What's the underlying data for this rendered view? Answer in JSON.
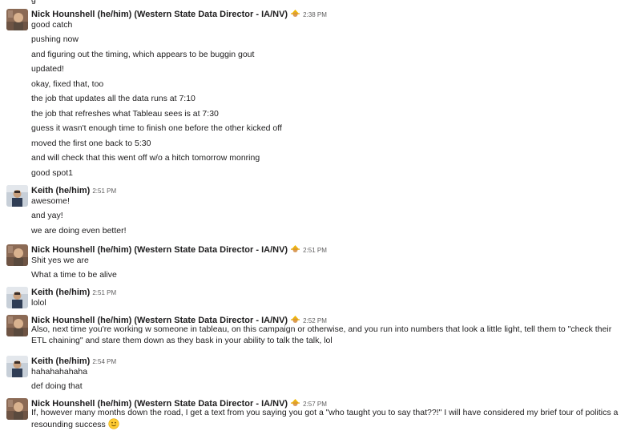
{
  "top_fragment": "g",
  "colors": {
    "text": "#1d1c1d",
    "timestamp": "#616061",
    "background": "#ffffff"
  },
  "groups": [
    {
      "sender": "Nick Hounshell (he/him) (Western State Data Director - IA/NV)",
      "status_emoji": "construction-worker-emoji",
      "time": "2:38 PM",
      "lines": [
        "good catch",
        "pushing now",
        "and figuring out the timing, which appears to be buggin gout",
        "updated!",
        "okay, fixed that, too",
        "the job that updates all the data runs at 7:10",
        "the job that refreshes what Tableau sees is at 7:30",
        "guess it wasn't enough time to finish one before the other kicked off",
        "moved the first one back to 5:30",
        "and will check that this went off w/o a hitch tomorrow monring",
        "good spot1"
      ]
    },
    {
      "sender": "Keith (he/him)",
      "time": "2:51 PM",
      "lines": [
        "awesome!",
        "and yay!",
        "we are doing even better!"
      ]
    },
    {
      "sender": "Nick Hounshell (he/him) (Western State Data Director - IA/NV)",
      "status_emoji": "construction-worker-emoji",
      "time": "2:51 PM",
      "lines": [
        "Shit yes we are",
        "What a time to be alive"
      ]
    },
    {
      "sender": "Keith (he/him)",
      "time": "2:51 PM",
      "lines": [
        "lolol"
      ]
    },
    {
      "sender": "Nick Hounshell (he/him) (Western State Data Director - IA/NV)",
      "status_emoji": "construction-worker-emoji",
      "time": "2:52 PM",
      "lines": [
        "Also, next time you're working w someone in tableau, on this campaign or otherwise, and you run into numbers that look a little light, tell them to \"check their ETL chaining\" and stare them down as they bask in your ability to talk the talk, lol"
      ]
    },
    {
      "sender": "Keith (he/him)",
      "time": "2:54 PM",
      "lines": [
        "hahahahahaha",
        "def doing that"
      ]
    },
    {
      "sender": "Nick Hounshell (he/him) (Western State Data Director - IA/NV)",
      "status_emoji": "construction-worker-emoji",
      "time": "2:57 PM",
      "lines": [
        "If, however many months down the road, I get a text from you saying you got a \"who taught you to say that??!\" I will have considered my brief tour of politics a resounding success"
      ],
      "trailing_emoji": "slightly-smiling-face-emoji"
    }
  ]
}
